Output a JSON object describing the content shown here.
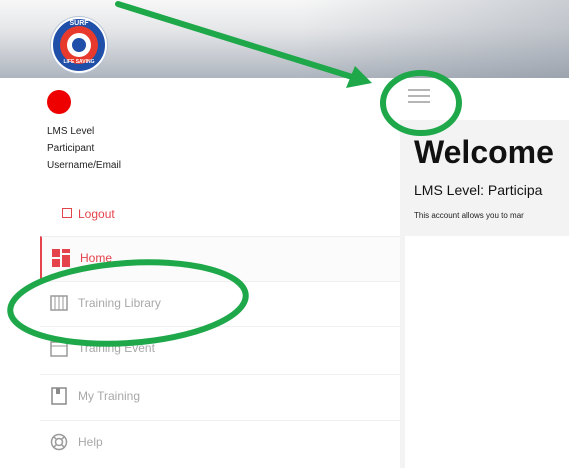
{
  "header": {
    "logo_top": "SURF",
    "logo_bottom": "LIFE SAVING"
  },
  "profile": {
    "lms_level": "LMS Level",
    "role": "Participant",
    "username": "Username/Email"
  },
  "logout_label": "Logout",
  "nav": {
    "items": [
      {
        "label": "Home",
        "icon": "home-grid-icon"
      },
      {
        "label": "Training Library",
        "icon": "library-icon"
      },
      {
        "label": "Training Event",
        "icon": "calendar-icon"
      },
      {
        "label": "My Training",
        "icon": "book-icon"
      },
      {
        "label": "Help",
        "icon": "help-lifebuoy-icon"
      }
    ]
  },
  "main": {
    "welcome": "Welcome",
    "lms_level_line": "LMS Level: Participa",
    "account_text": "This account allows you to mar"
  },
  "colors": {
    "accent": "#e4434c",
    "annotation": "#1ea84a",
    "status": "#ee0000"
  }
}
